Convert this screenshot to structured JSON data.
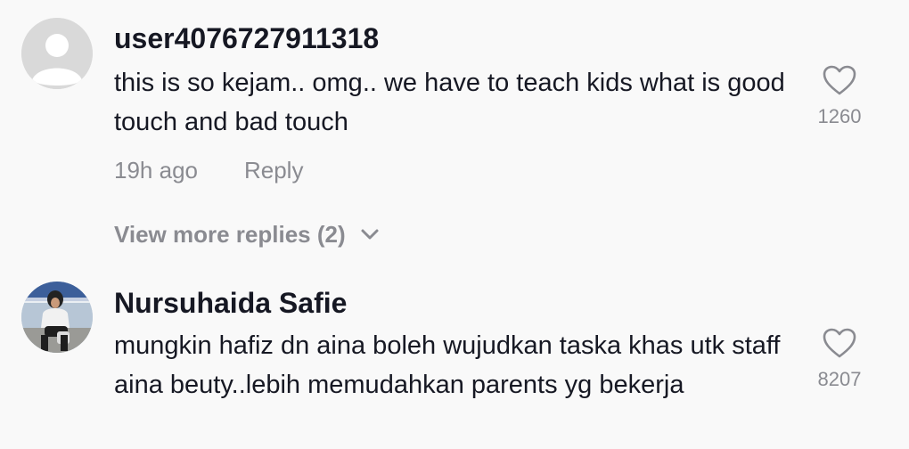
{
  "comments": [
    {
      "username": "user4076727911318",
      "avatar_icon": "default-avatar-icon",
      "text": "this is so kejam.. omg.. we have to teach kids what is good touch and bad touch",
      "time": "19h ago",
      "reply_label": "Reply",
      "view_more_label": "View more replies (2)",
      "like_count": "1260"
    },
    {
      "username": "Nursuhaida Safie",
      "avatar_icon": "user-photo-avatar",
      "text": "mungkin hafiz dn aina boleh wujudkan taska khas utk staff aina beuty..lebih memudahkan parents yg bekerja",
      "like_count": "8207"
    }
  ],
  "colors": {
    "background": "#f9f9f9",
    "text_primary": "#161823",
    "text_secondary": "#8a8b91",
    "avatar_default": "#d9d9d9"
  }
}
